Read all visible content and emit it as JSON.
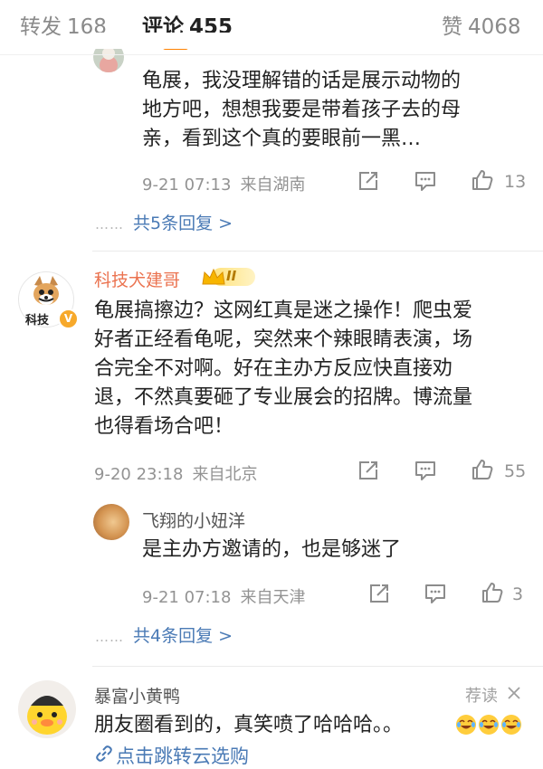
{
  "tabs": {
    "repost": {
      "label": "转发",
      "count": "168"
    },
    "comments": {
      "label": "评论",
      "count": "455"
    },
    "likes": {
      "label": "赞",
      "count": "4068"
    }
  },
  "comment1": {
    "text_lines": [
      "龟展，我没理解错的话是展示动物的",
      "地方吧，想想我要是带着孩子去的母",
      "亲，看到这个真的要眼前一黑…"
    ],
    "time": "9-21 07:13",
    "location": "来自湖南",
    "likes": "13",
    "replies_link": "共5条回复 >"
  },
  "comment2": {
    "username": "科技犬建哥",
    "avatar_text": "科技",
    "badge": "II",
    "text_lines": [
      "龟展搞擦边？这网红真是迷之操作！爬虫爱",
      "好者正经看龟呢，突然来个辣眼睛表演，场",
      "合完全不对啊。好在主办方反应快直接劝",
      "退，不然真要砸了专业展会的招牌。博流量",
      "也得看场合吧！"
    ],
    "time": "9-20 23:18",
    "location": "来自北京",
    "likes": "55",
    "reply": {
      "username": "飞翔的小妞洋",
      "text": "是主办方邀请的，也是够迷了",
      "time": "9-21 07:18",
      "location": "来自天津",
      "likes": "3"
    },
    "replies_link": "共4条回复 >"
  },
  "comment3": {
    "username": "暴富小黄鸭",
    "recommend_label": "荐读",
    "text": "朋友圈看到的，真笑喷了哈哈哈。。",
    "link_text": "点击跳转云选购"
  },
  "colors": {
    "accent": "#ff8200",
    "link": "#4a7ab5",
    "username_highlight": "#eb7350",
    "meta": "#939393"
  }
}
